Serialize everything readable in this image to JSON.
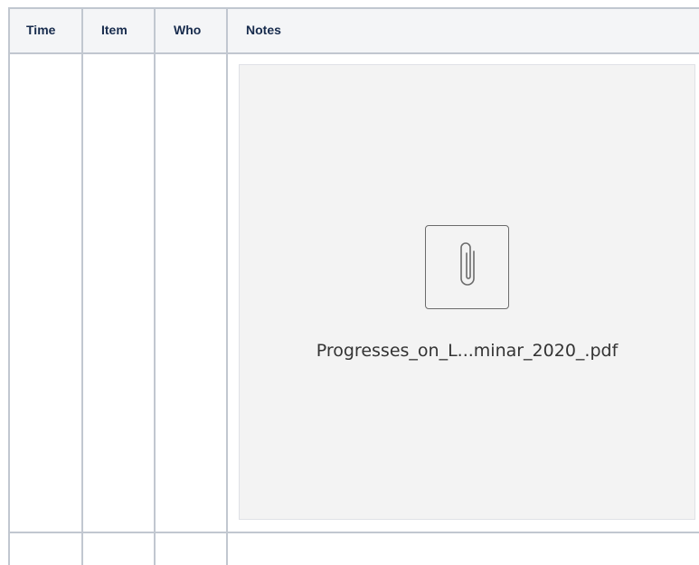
{
  "table": {
    "headers": {
      "time": "Time",
      "item": "Item",
      "who": "Who",
      "notes": "Notes"
    }
  },
  "attachment": {
    "icon": "paperclip-icon",
    "filename": "Progresses_on_L...minar_2020_.pdf"
  },
  "colors": {
    "header_bg": "#f4f5f7",
    "border": "#c1c7d0",
    "attachment_bg": "#f3f3f3",
    "text": "#172b4d"
  }
}
